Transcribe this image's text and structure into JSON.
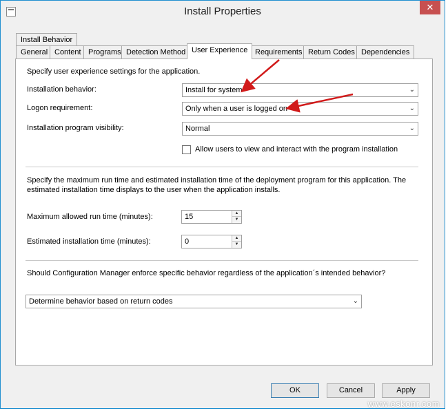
{
  "window": {
    "title": "Install Properties"
  },
  "tabs_row1": [
    {
      "label": "Install Behavior"
    }
  ],
  "tabs_row2": [
    {
      "label": "General"
    },
    {
      "label": "Content"
    },
    {
      "label": "Programs"
    },
    {
      "label": "Detection Method"
    },
    {
      "label": "User Experience",
      "active": true
    },
    {
      "label": "Requirements"
    },
    {
      "label": "Return Codes"
    },
    {
      "label": "Dependencies"
    }
  ],
  "user_experience": {
    "intro": "Specify user experience settings for the application.",
    "installation_behavior": {
      "label": "Installation behavior:",
      "value": "Install for system"
    },
    "logon_requirement": {
      "label": "Logon requirement:",
      "value": "Only when a user is logged on"
    },
    "visibility": {
      "label": "Installation program visibility:",
      "value": "Normal"
    },
    "allow_interact": {
      "label": "Allow users to view and interact with the program installation",
      "checked": false
    },
    "runtime_desc": "Specify the maximum run time and estimated installation time of the deployment program for this application. The estimated installation time displays to the user when the application installs.",
    "max_runtime": {
      "label": "Maximum allowed run time (minutes):",
      "value": "15"
    },
    "est_time": {
      "label": "Estimated installation time (minutes):",
      "value": "0"
    },
    "enforce_question": "Should Configuration Manager enforce specific behavior regardless of the application´s intended behavior?",
    "enforce_behavior": {
      "value": "Determine behavior based on return codes"
    }
  },
  "buttons": {
    "ok": "OK",
    "cancel": "Cancel",
    "apply": "Apply"
  },
  "watermark": "www.eskonr.com",
  "colors": {
    "arrow": "#d11a1a",
    "close": "#c75050",
    "frame": "#1f8fd0"
  }
}
